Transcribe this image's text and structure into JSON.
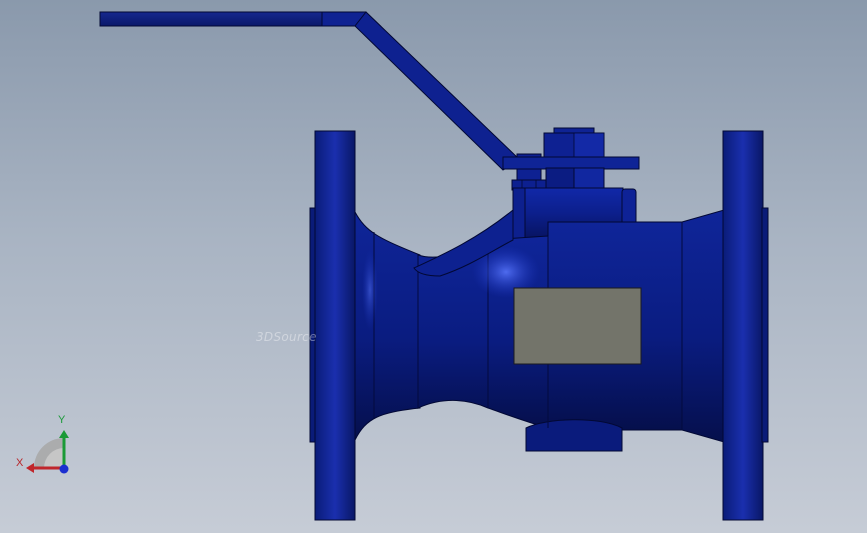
{
  "viewport": {
    "watermark_text": "3DSource",
    "colors": {
      "body_blue": "#0c1f8a",
      "body_dark": "#061054",
      "highlight_blue": "#2f4fd6",
      "nameplate_gray": "#73746a",
      "outline": "#020834"
    }
  },
  "triad": {
    "x_label": "X",
    "y_label": "Y",
    "colors": {
      "x_axis": "#c0262b",
      "y_axis": "#1a9a36",
      "z_axis": "#1b2fd0"
    }
  }
}
